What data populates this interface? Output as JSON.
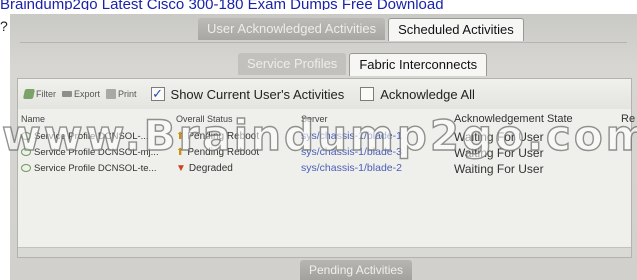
{
  "top_link": "Braindump2go Latest Cisco 300-180 Exam Dumps Free Download",
  "question_mark": "?",
  "tabs_main": [
    {
      "label": "User Acknowledged Activities",
      "active": false
    },
    {
      "label": "Scheduled Activities",
      "active": true
    }
  ],
  "tabs_sub": [
    {
      "label": "Service Profiles",
      "active": false
    },
    {
      "label": "Fabric Interconnects",
      "active": true
    }
  ],
  "toolbar": {
    "filter": "Filter",
    "export": "Export",
    "print": "Print",
    "show_current": "Show Current User's Activities",
    "show_current_checked": true,
    "ack_all": "Acknowledge All",
    "ack_all_checked": false
  },
  "table": {
    "headers": {
      "name": "Name",
      "status": "Overall Status",
      "server": "Server",
      "ack": "Acknowledgement State",
      "extra": "Re"
    },
    "rows": [
      {
        "name": "Service Profile DCNSOL-...",
        "status": "Pending Reboot",
        "server": "sys/chassis-1/blade-1",
        "ack": "Waiting For User"
      },
      {
        "name": "Service Profile DCNSOL-mj...",
        "status": "Pending Reboot",
        "server": "sys/chassis-1/blade-3",
        "ack": "Waiting For User"
      },
      {
        "name": "Service Profile DCNSOL-te...",
        "status": "Degraded",
        "server": "sys/chassis-1/blade-2",
        "ack": "Waiting For User"
      }
    ]
  },
  "bottom_tab": "Pending Activities",
  "watermark": "www.Braindump2go.com"
}
